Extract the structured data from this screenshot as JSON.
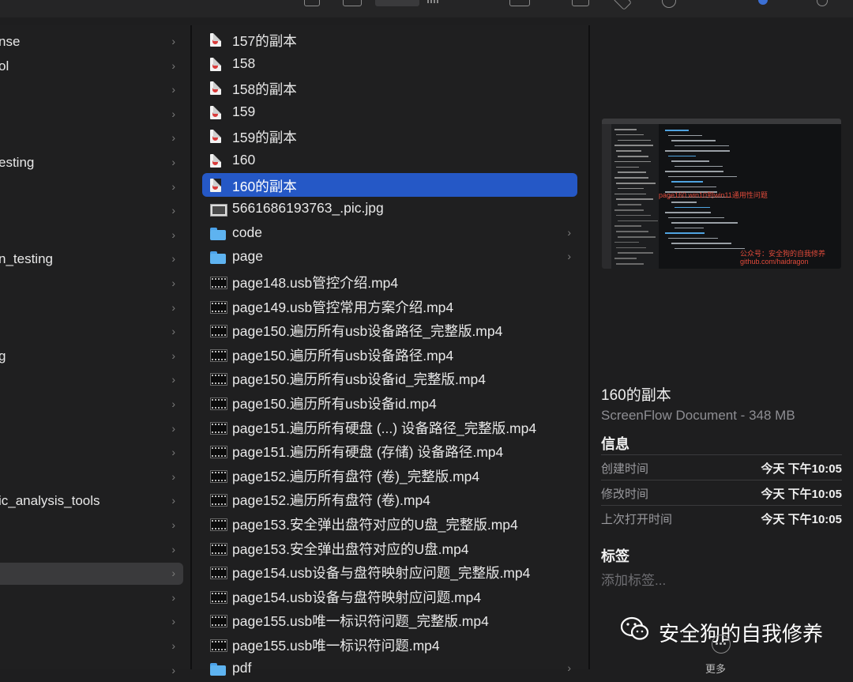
{
  "sidebar": {
    "items": [
      {
        "label": "nse"
      },
      {
        "label": "ol"
      },
      {
        "label": ""
      },
      {
        "label": ""
      },
      {
        "label": ""
      },
      {
        "label": "esting"
      },
      {
        "label": ""
      },
      {
        "label": ""
      },
      {
        "label": ""
      },
      {
        "label": "n_testing"
      },
      {
        "label": ""
      },
      {
        "label": ""
      },
      {
        "label": ""
      },
      {
        "label": "g"
      },
      {
        "label": ""
      },
      {
        "label": ""
      },
      {
        "label": ""
      },
      {
        "label": ""
      },
      {
        "label": ""
      },
      {
        "label": "ic_analysis_tools"
      },
      {
        "label": ""
      },
      {
        "label": ""
      },
      {
        "label": "",
        "selected": true
      },
      {
        "label": ""
      },
      {
        "label": ""
      },
      {
        "label": ""
      },
      {
        "label": ""
      }
    ]
  },
  "files": [
    {
      "name": "157的副本",
      "kind": "doc"
    },
    {
      "name": "158",
      "kind": "doc"
    },
    {
      "name": "158的副本",
      "kind": "doc"
    },
    {
      "name": "159",
      "kind": "doc"
    },
    {
      "name": "159的副本",
      "kind": "doc"
    },
    {
      "name": "160",
      "kind": "doc"
    },
    {
      "name": "160的副本",
      "kind": "doc",
      "selected": true
    },
    {
      "name": "5661686193763_.pic.jpg",
      "kind": "image"
    },
    {
      "name": "code",
      "kind": "folder"
    },
    {
      "name": "page",
      "kind": "folder"
    },
    {
      "name": "page148.usb管控介绍.mp4",
      "kind": "video"
    },
    {
      "name": "page149.usb管控常用方案介绍.mp4",
      "kind": "video"
    },
    {
      "name": "page150.遍历所有usb设备路径_完整版.mp4",
      "kind": "video"
    },
    {
      "name": "page150.遍历所有usb设备路径.mp4",
      "kind": "video"
    },
    {
      "name": "page150.遍历所有usb设备id_完整版.mp4",
      "kind": "video"
    },
    {
      "name": "page150.遍历所有usb设备id.mp4",
      "kind": "video"
    },
    {
      "name": "page151.遍历所有硬盘 (...) 设备路径_完整版.mp4",
      "kind": "video"
    },
    {
      "name": "page151.遍历所有硬盘 (存储) 设备路径.mp4",
      "kind": "video"
    },
    {
      "name": "page152.遍历所有盘符 (卷)_完整版.mp4",
      "kind": "video"
    },
    {
      "name": "page152.遍历所有盘符 (卷).mp4",
      "kind": "video"
    },
    {
      "name": "page153.安全弹出盘符对应的U盘_完整版.mp4",
      "kind": "video"
    },
    {
      "name": "page153.安全弹出盘符对应的U盘.mp4",
      "kind": "video"
    },
    {
      "name": "page154.usb设备与盘符映射应问题_完整版.mp4",
      "kind": "video"
    },
    {
      "name": "page154.usb设备与盘符映射应问题.mp4",
      "kind": "video"
    },
    {
      "name": "page155.usb唯一标识符问题_完整版.mp4",
      "kind": "video"
    },
    {
      "name": "page155.usb唯一标识符问题.mp4",
      "kind": "video"
    },
    {
      "name": "pdf",
      "kind": "folder"
    }
  ],
  "preview": {
    "overlay_text": "page160.win10到win11通用性问题",
    "watermark_line1": "公众号：安全狗的自我修养",
    "watermark_line2": "github.com/haidragon"
  },
  "details": {
    "title": "160的副本",
    "subtitle": "ScreenFlow Document - 348 MB",
    "info_heading": "信息",
    "info": [
      {
        "key": "创建时间",
        "value": "今天 下午10:05"
      },
      {
        "key": "修改时间",
        "value": "今天 下午10:05"
      },
      {
        "key": "上次打开时间",
        "value": "今天 下午10:05"
      }
    ],
    "tags_heading": "标签",
    "tags_placeholder": "添加标签...",
    "more_label": "更多"
  },
  "watermark": {
    "text": "安全狗的自我修养"
  },
  "colors": {
    "selection": "#2558c6",
    "background": "#1f1f20",
    "folder": "#5eb3f0"
  }
}
